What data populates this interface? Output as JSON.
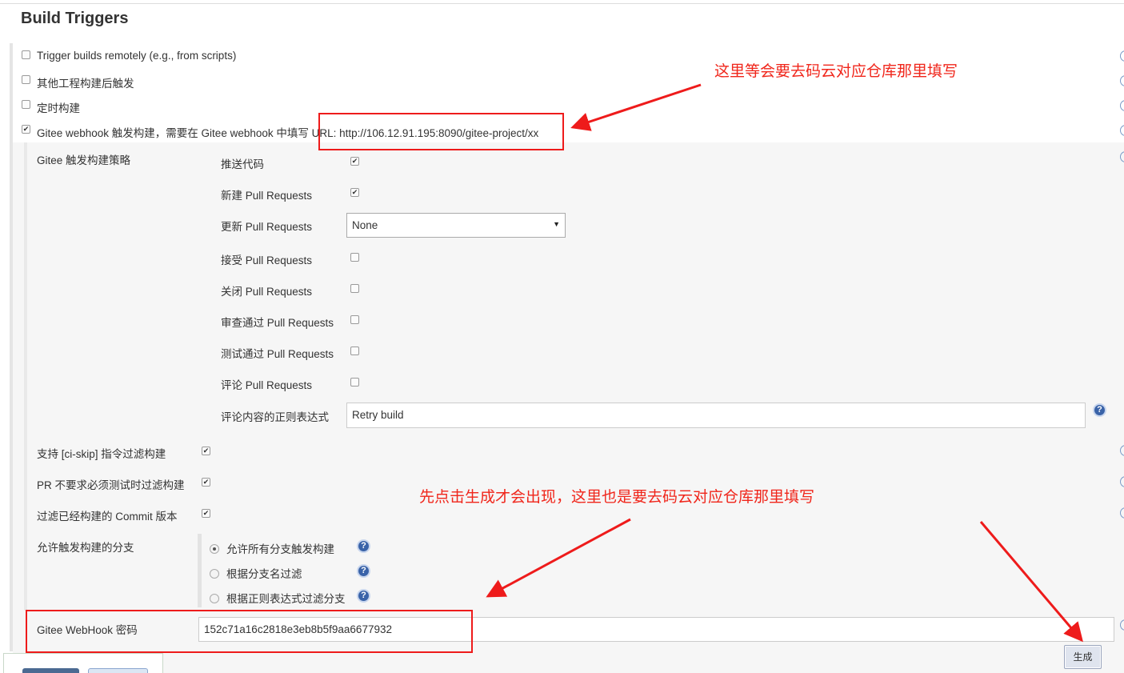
{
  "section_title": "Build Triggers",
  "triggers": [
    {
      "label": "Trigger builds remotely (e.g., from scripts)",
      "checked": false
    },
    {
      "label": "其他工程构建后触发",
      "checked": false
    },
    {
      "label": "定时构建",
      "checked": false
    },
    {
      "label": "Gitee webhook 触发构建，需要在 Gitee webhook 中填写 URL: http://106.12.91.195:8090/gitee-project/xx",
      "checked": true
    }
  ],
  "strategy": {
    "label": "Gitee 触发构建策略",
    "items": [
      {
        "label": "推送代码",
        "checked": true
      },
      {
        "label": "新建 Pull Requests",
        "checked": true
      },
      {
        "label": "更新 Pull Requests",
        "select_value": "None"
      },
      {
        "label": "接受 Pull Requests",
        "checked": false
      },
      {
        "label": "关闭 Pull Requests",
        "checked": false
      },
      {
        "label": "审查通过 Pull Requests",
        "checked": false
      },
      {
        "label": "测试通过 Pull Requests",
        "checked": false
      },
      {
        "label": "评论 Pull Requests",
        "checked": false
      },
      {
        "label": "评论内容的正则表达式",
        "input_value": "Retry build"
      }
    ]
  },
  "options": [
    {
      "label": "支持 [ci-skip] 指令过滤构建",
      "checked": true
    },
    {
      "label": "PR 不要求必须测试时过滤构建",
      "checked": true
    },
    {
      "label": "过滤已经构建的 Commit 版本",
      "checked": true
    }
  ],
  "branch": {
    "label": "允许触发构建的分支",
    "options": [
      {
        "label": "允许所有分支触发构建",
        "selected": true
      },
      {
        "label": "根据分支名过滤",
        "selected": false
      },
      {
        "label": "根据正则表达式过滤分支",
        "selected": false
      }
    ]
  },
  "webhook": {
    "label": "Gitee WebHook 密码",
    "value": "152c71a16c2818e3eb8b5f9aa6677932",
    "generate_label": "生成"
  },
  "help_glyph": "?",
  "annotations": {
    "note_url": "这里等会要去码云对应仓库那里填写",
    "note_password": "先点击生成才会出现，这里也是要去码云对应仓库那里填写",
    "color": "#f0261b"
  }
}
